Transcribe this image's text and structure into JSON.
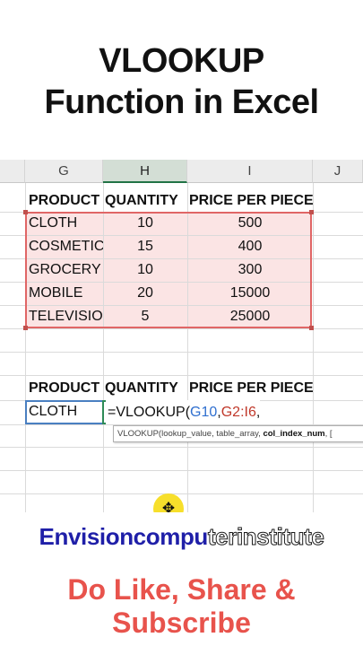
{
  "title": {
    "line1": "VLOOKUP",
    "line2": "Function in Excel"
  },
  "sheet": {
    "columns": [
      "G",
      "H",
      "I",
      "J"
    ],
    "table_header": [
      "PRODUCT",
      "QUANTITY",
      "PRICE PER PIECE"
    ],
    "rows": [
      [
        "CLOTH",
        "10",
        "500"
      ],
      [
        "COSMETIC",
        "15",
        "400"
      ],
      [
        "GROCERY",
        "10",
        "300"
      ],
      [
        "MOBILE",
        "20",
        "15000"
      ],
      [
        "TELEVISIO",
        "5",
        "25000"
      ]
    ],
    "lookup_header": [
      "PRODUCT",
      "QUANTITY",
      "PRICE PER PIECE"
    ],
    "lookup_value": "CLOTH",
    "formula": {
      "prefix": "=VLOOKUP(",
      "arg1": "G10",
      "sep1": ",",
      "arg2": "G2:I6",
      "sep2": ","
    },
    "tooltip": {
      "signature": "VLOOKUP(lookup_value, table_array, ",
      "current_arg": "col_index_num",
      "rest": ", ["
    },
    "cursor_glyph": "✥",
    "colors": {
      "accent_excel_green": "#217346",
      "table_fill": "#fbe4e4",
      "table_border": "#e06666",
      "ref_blue": "#2f6fcf",
      "ref_red": "#c0392b"
    }
  },
  "brand": {
    "part1": "Envisioncompu",
    "part2": "terinstitute"
  },
  "cta": {
    "line1": "Do Like, Share &",
    "line2": "Subscribe"
  }
}
